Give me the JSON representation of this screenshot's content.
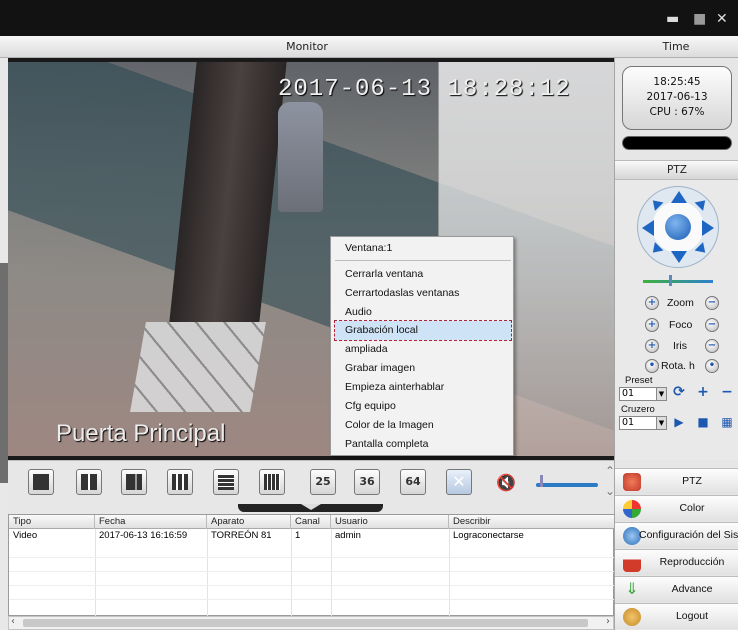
{
  "window": {
    "minimize": "▬",
    "restore": "■",
    "close": "✕"
  },
  "header": {
    "monitor": "Monitor",
    "time": "Time"
  },
  "video": {
    "osd_datetime": "2017-06-13 18:28:12",
    "osd_camera_name": "Puerta Principal"
  },
  "context_menu": {
    "title": "Ventana:1",
    "items": [
      "Cerrarla ventana",
      "Cerrartodaslas ventanas",
      "Audio",
      "Grabación local",
      "ampliada",
      "Grabar imagen",
      "Empieza ainterhablar",
      "Cfg equipo",
      "Color de la Imagen",
      "Pantalla completa"
    ],
    "highlighted_index": 3
  },
  "toolbar": {
    "layouts": [
      "1",
      "4",
      "6",
      "9",
      "13",
      "16"
    ],
    "layout_labels": [
      "25",
      "36",
      "64"
    ],
    "volume": 0.9
  },
  "log_table": {
    "headers": [
      "Tipo",
      "Fecha",
      "Aparato",
      "Canal",
      "Usuario",
      "Describir"
    ],
    "rows": [
      [
        "Video",
        "2017-06-13 16:16:59",
        "TORREÓN 81",
        "1",
        "admin",
        "Lograconectarse"
      ]
    ]
  },
  "status": {
    "time": "18:25:45",
    "date": "2017-06-13",
    "cpu": "CPU : 67%"
  },
  "ptz": {
    "title": "PTZ",
    "speed": 0.4,
    "zoom_label": "Zoom",
    "focus_label": "Foco",
    "iris_label": "Iris",
    "rotate_label": "Rota. h",
    "preset_label": "Preset",
    "preset_value": "01",
    "cruise_label": "Cruzero",
    "cruise_value": "01"
  },
  "side_menu": [
    {
      "label": "PTZ",
      "icon": "ptz-icon",
      "color": "#c0392b"
    },
    {
      "label": "Color",
      "icon": "color-icon",
      "color": "#2f7bd2"
    },
    {
      "label": "Configuración del Sistema",
      "icon": "config-icon",
      "color": "#2a6fb8"
    },
    {
      "label": "Reproducción",
      "icon": "playback-icon",
      "color": "#d23a2a"
    },
    {
      "label": "Advance",
      "icon": "advance-icon",
      "color": "#3aa33a"
    },
    {
      "label": "Logout",
      "icon": "logout-icon",
      "color": "#c38a2a"
    }
  ]
}
